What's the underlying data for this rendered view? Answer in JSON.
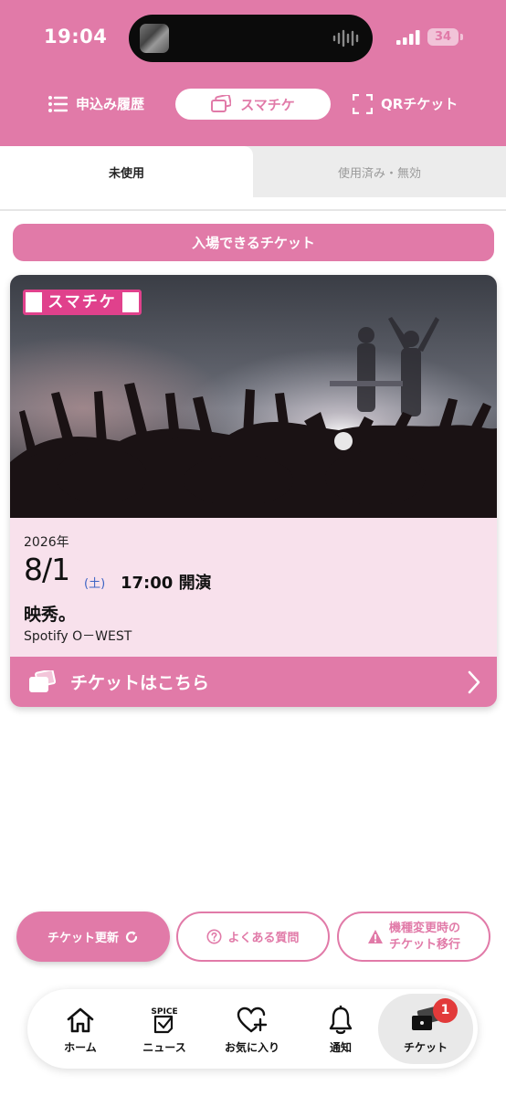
{
  "status_bar": {
    "time": "19:04",
    "battery": "34"
  },
  "top_nav": {
    "history_label": "申込み履歴",
    "smachike_label": "スマチケ",
    "qr_label": "QRチケット"
  },
  "tabs": {
    "unused": "未使用",
    "used": "使用済み・無効"
  },
  "section_label": "入場できるチケット",
  "ticket": {
    "logo_text": "スマチケ",
    "year": "2026年",
    "date": "8/1",
    "weekday": "(土)",
    "time": "17:00 開演",
    "title": "映秀。",
    "venue": "Spotify O－WEST",
    "footer_label": "チケットはこちら"
  },
  "buttons": {
    "update": "チケット更新",
    "faq": "よくある質問",
    "migrate_line1": "機種変更時の",
    "migrate_line2": "チケット移行"
  },
  "bottom_nav": {
    "home": "ホーム",
    "news": "ニュース",
    "spice_text": "SPICE",
    "favorites": "お気に入り",
    "notifications": "通知",
    "tickets": "チケット",
    "badge_count": "1"
  },
  "colors": {
    "accent": "#e17aa8",
    "card_bg": "#f8e1ec",
    "badge": "#e23a3a",
    "weekday": "#3c63c4"
  },
  "icons": {
    "history": "list-icon",
    "smachike": "tickets-icon",
    "qr": "qr-frame-icon",
    "refresh": "refresh-icon",
    "faq": "question-circle-icon",
    "migrate": "warning-icon",
    "home": "house-icon",
    "news": "spice-news-icon",
    "favorites": "heart-plus-icon",
    "notifications": "bell-icon",
    "tickets": "ticket-stack-icon",
    "chevron": "chevron-right-icon"
  }
}
